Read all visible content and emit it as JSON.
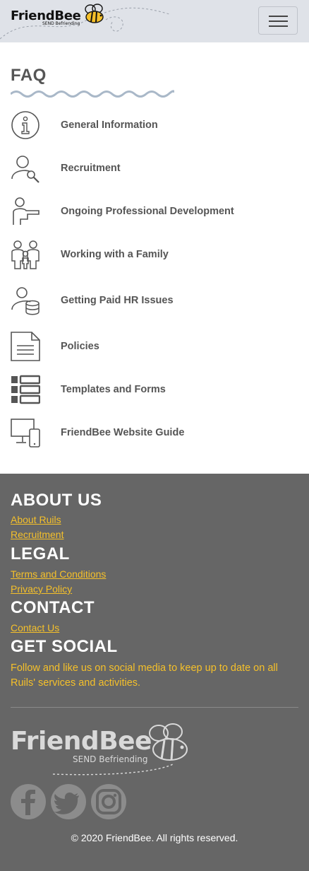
{
  "header": {
    "logo_text_a": "Friend",
    "logo_text_b": "Bee",
    "logo_tagline": "SEND Befriending",
    "menu_icon": "hamburger-icon"
  },
  "faq": {
    "title": "FAQ",
    "items": [
      {
        "label": "General Information",
        "icon": "info-icon"
      },
      {
        "label": "Recruitment",
        "icon": "user-search-icon"
      },
      {
        "label": "Ongoing Professional Development",
        "icon": "teacher-icon"
      },
      {
        "label": "Working with a Family",
        "icon": "family-icon"
      },
      {
        "label": "Getting Paid HR Issues",
        "icon": "user-coins-icon"
      },
      {
        "label": "Policies",
        "icon": "document-icon"
      },
      {
        "label": "Templates and Forms",
        "icon": "list-icon"
      },
      {
        "label": "FriendBee Website Guide",
        "icon": "devices-icon"
      }
    ]
  },
  "footer": {
    "about_heading": "ABOUT US",
    "about_links": [
      "About Ruils",
      "Recruitment"
    ],
    "legal_heading": "LEGAL",
    "legal_links": [
      "Terms and Conditions",
      "Privacy Policy"
    ],
    "contact_heading": "CONTACT",
    "contact_links": [
      "Contact Us"
    ],
    "social_heading": "GET SOCIAL",
    "social_text": "Follow and like us on social media to keep up to date on all Ruils' services and activities.",
    "logo_text": "FriendBee",
    "logo_tagline": "SEND Befriending",
    "social_icons": [
      "facebook-icon",
      "twitter-icon",
      "instagram-icon"
    ],
    "copyright": "© 2020 FriendBee. All rights reserved."
  },
  "colors": {
    "header_bg": "#dfe2e8",
    "text": "#555555",
    "footer_bg": "#666666",
    "link": "#f5c02a"
  }
}
